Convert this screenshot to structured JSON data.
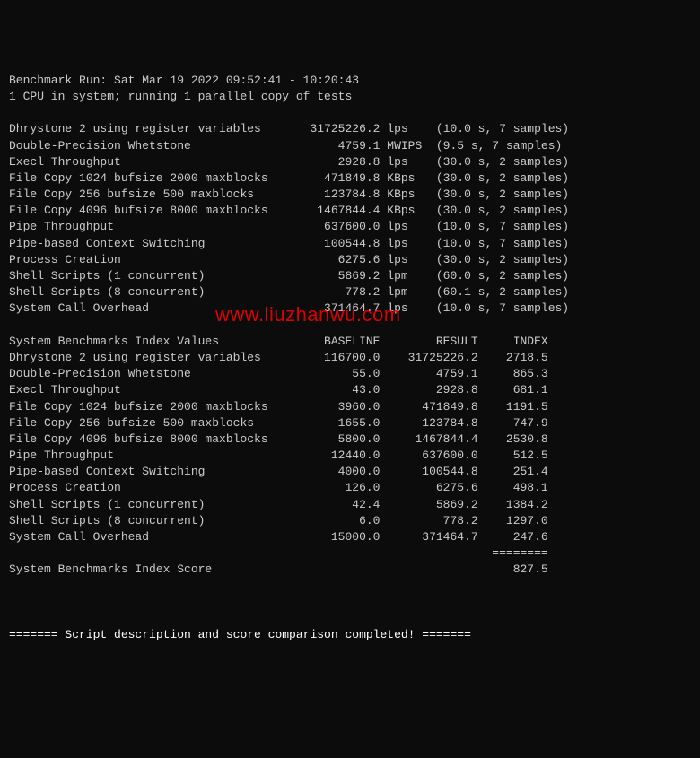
{
  "header": {
    "run_line": "Benchmark Run: Sat Mar 19 2022 09:52:41 - 10:20:43",
    "cpu_line": "1 CPU in system; running 1 parallel copy of tests"
  },
  "tests": [
    {
      "name": "Dhrystone 2 using register variables",
      "value": "31725226.2",
      "unit": "lps",
      "timing": "(10.0 s, 7 samples)"
    },
    {
      "name": "Double-Precision Whetstone",
      "value": "4759.1",
      "unit": "MWIPS",
      "timing": "(9.5 s, 7 samples)"
    },
    {
      "name": "Execl Throughput",
      "value": "2928.8",
      "unit": "lps",
      "timing": "(30.0 s, 2 samples)"
    },
    {
      "name": "File Copy 1024 bufsize 2000 maxblocks",
      "value": "471849.8",
      "unit": "KBps",
      "timing": "(30.0 s, 2 samples)"
    },
    {
      "name": "File Copy 256 bufsize 500 maxblocks",
      "value": "123784.8",
      "unit": "KBps",
      "timing": "(30.0 s, 2 samples)"
    },
    {
      "name": "File Copy 4096 bufsize 8000 maxblocks",
      "value": "1467844.4",
      "unit": "KBps",
      "timing": "(30.0 s, 2 samples)"
    },
    {
      "name": "Pipe Throughput",
      "value": "637600.0",
      "unit": "lps",
      "timing": "(10.0 s, 7 samples)"
    },
    {
      "name": "Pipe-based Context Switching",
      "value": "100544.8",
      "unit": "lps",
      "timing": "(10.0 s, 7 samples)"
    },
    {
      "name": "Process Creation",
      "value": "6275.6",
      "unit": "lps",
      "timing": "(30.0 s, 2 samples)"
    },
    {
      "name": "Shell Scripts (1 concurrent)",
      "value": "5869.2",
      "unit": "lpm",
      "timing": "(60.0 s, 2 samples)"
    },
    {
      "name": "Shell Scripts (8 concurrent)",
      "value": "778.2",
      "unit": "lpm",
      "timing": "(60.1 s, 2 samples)"
    },
    {
      "name": "System Call Overhead",
      "value": "371464.7",
      "unit": "lps",
      "timing": "(10.0 s, 7 samples)"
    }
  ],
  "index_header": {
    "title": "System Benchmarks Index Values",
    "col_baseline": "BASELINE",
    "col_result": "RESULT",
    "col_index": "INDEX"
  },
  "index_rows": [
    {
      "name": "Dhrystone 2 using register variables",
      "baseline": "116700.0",
      "result": "31725226.2",
      "index": "2718.5"
    },
    {
      "name": "Double-Precision Whetstone",
      "baseline": "55.0",
      "result": "4759.1",
      "index": "865.3"
    },
    {
      "name": "Execl Throughput",
      "baseline": "43.0",
      "result": "2928.8",
      "index": "681.1"
    },
    {
      "name": "File Copy 1024 bufsize 2000 maxblocks",
      "baseline": "3960.0",
      "result": "471849.8",
      "index": "1191.5"
    },
    {
      "name": "File Copy 256 bufsize 500 maxblocks",
      "baseline": "1655.0",
      "result": "123784.8",
      "index": "747.9"
    },
    {
      "name": "File Copy 4096 bufsize 8000 maxblocks",
      "baseline": "5800.0",
      "result": "1467844.4",
      "index": "2530.8"
    },
    {
      "name": "Pipe Throughput",
      "baseline": "12440.0",
      "result": "637600.0",
      "index": "512.5"
    },
    {
      "name": "Pipe-based Context Switching",
      "baseline": "4000.0",
      "result": "100544.8",
      "index": "251.4"
    },
    {
      "name": "Process Creation",
      "baseline": "126.0",
      "result": "6275.6",
      "index": "498.1"
    },
    {
      "name": "Shell Scripts (1 concurrent)",
      "baseline": "42.4",
      "result": "5869.2",
      "index": "1384.2"
    },
    {
      "name": "Shell Scripts (8 concurrent)",
      "baseline": "6.0",
      "result": "778.2",
      "index": "1297.0"
    },
    {
      "name": "System Call Overhead",
      "baseline": "15000.0",
      "result": "371464.7",
      "index": "247.6"
    }
  ],
  "divider": "========",
  "score": {
    "label": "System Benchmarks Index Score",
    "value": "827.5"
  },
  "footer": "======= Script description and score comparison completed! =======",
  "watermark": "www.liuzhanwu.com"
}
